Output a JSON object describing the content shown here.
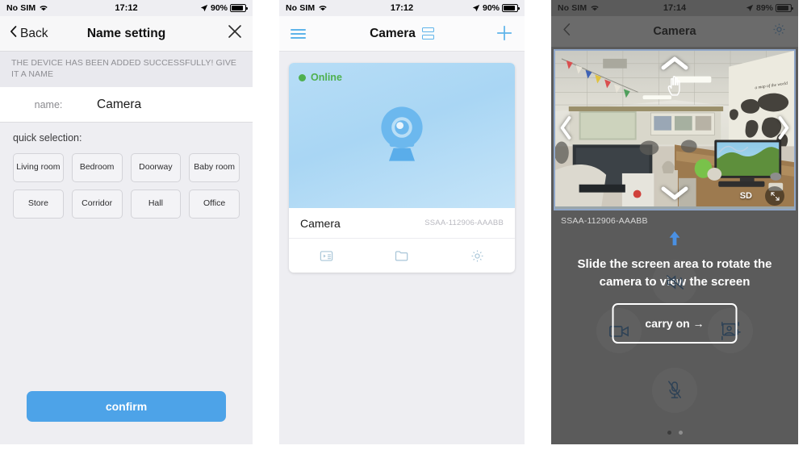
{
  "panel1": {
    "status": {
      "carrier": "No SIM",
      "time": "17:12",
      "battery_pct": "90%",
      "wifi_icon": "wifi-icon",
      "location_icon": "location-arrow-icon",
      "battery_icon": "battery-icon"
    },
    "nav": {
      "back_label": "Back",
      "title": "Name setting",
      "close_icon": "close-icon",
      "back_icon": "chevron-left-icon"
    },
    "hint": "THE DEVICE HAS BEEN ADDED SUCCESSFULLY! GIVE IT A NAME",
    "name_field": {
      "label": "name:",
      "value": "Camera",
      "placeholder": "Camera"
    },
    "quick_selection": {
      "title": "quick selection:",
      "options": [
        "Living room",
        "Bedroom",
        "Doorway",
        "Baby room",
        "Store",
        "Corridor",
        "Hall",
        "Office"
      ]
    },
    "confirm_label": "confirm",
    "accent_color": "#4da3e8"
  },
  "panel2": {
    "status": {
      "carrier": "No SIM",
      "time": "17:12",
      "battery_pct": "90%",
      "wifi_icon": "wifi-icon",
      "location_icon": "location-arrow-icon",
      "battery_icon": "battery-icon"
    },
    "nav": {
      "menu_icon": "hamburger-menu-icon",
      "title": "Camera",
      "grid_toggle_icon": "list-grid-toggle-icon",
      "add_icon": "plus-icon"
    },
    "card": {
      "status_label": "Online",
      "status_color": "#4fb04f",
      "device_icon": "camera-device-icon",
      "name": "Camera",
      "uid": "SSAA-112906-AAABB",
      "actions": [
        {
          "icon": "playback-list-icon",
          "name": "playback"
        },
        {
          "icon": "folder-icon",
          "name": "files"
        },
        {
          "icon": "gear-icon",
          "name": "settings"
        }
      ]
    },
    "accent_color": "#5eb4ea"
  },
  "panel3": {
    "status": {
      "carrier": "No SIM",
      "time": "17:14",
      "battery_pct": "89%",
      "wifi_icon": "wifi-icon",
      "location_icon": "location-arrow-icon",
      "battery_icon": "battery-icon"
    },
    "nav": {
      "back_icon": "chevron-left-icon",
      "title": "Camera",
      "settings_icon": "gear-icon"
    },
    "video": {
      "pan_up_icon": "chevron-up-icon",
      "pan_down_icon": "chevron-down-icon",
      "pan_left_icon": "chevron-left-icon",
      "pan_right_icon": "chevron-right-icon",
      "hand_icon": "hand-pointer-icon",
      "quality_badge": "SD",
      "fullscreen_icon": "fullscreen-icon"
    },
    "uid": "SSAA-112906-AAABB",
    "tutorial": {
      "arrow_icon": "arrow-up-icon",
      "arrow_color": "#4a90e2",
      "text": "Slide the screen area to rotate the camera to view the screen",
      "button_label": "carry on →"
    },
    "controls": [
      {
        "icon": "speaker-mute-icon",
        "name": "speaker"
      },
      {
        "icon": "video-record-icon",
        "name": "record"
      },
      {
        "icon": "snapshot-icon",
        "name": "snapshot"
      },
      {
        "icon": "microphone-mute-icon",
        "name": "microphone"
      }
    ],
    "page_dots": {
      "total": 2,
      "active": 0
    }
  }
}
